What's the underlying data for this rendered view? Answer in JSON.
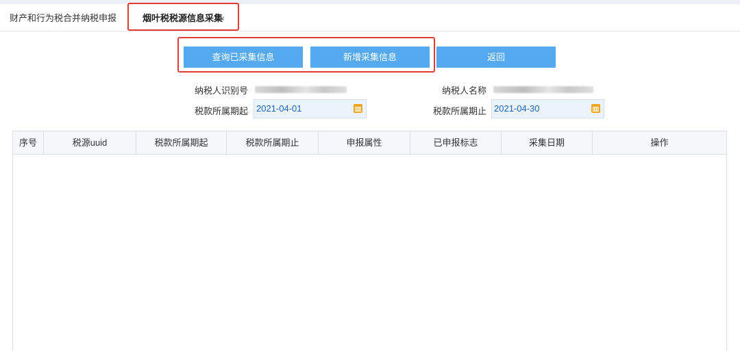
{
  "tabs": [
    {
      "label": "财产和行为税合并纳税申报"
    },
    {
      "label": "烟叶税税源信息采集",
      "close": "×"
    }
  ],
  "buttons": {
    "query": "查询已采集信息",
    "add": "新增采集信息",
    "back": "返回"
  },
  "form": {
    "taxpayer_id_label": "纳税人识别号",
    "taxpayer_name_label": "纳税人名称",
    "period_start_label": "税款所属期起",
    "period_start_value": "2021-04-01",
    "period_end_label": "税款所属期止",
    "period_end_value": "2021-04-30"
  },
  "table": {
    "columns": [
      "序号",
      "税源uuid",
      "税款所属期起",
      "税款所属期止",
      "申报属性",
      "已申报标志",
      "采集日期",
      "操作"
    ],
    "rows": []
  },
  "colors": {
    "button": "#55a9ee",
    "highlight_box": "#e53935",
    "calendar_icon": "#f2a521",
    "date_text": "#1a64b8"
  }
}
